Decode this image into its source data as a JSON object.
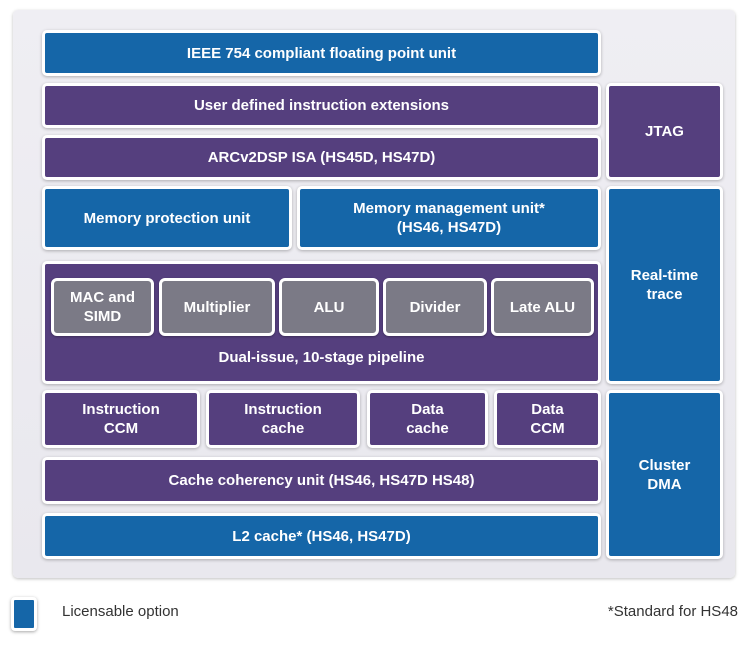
{
  "colors": {
    "licensable_blue": "#1566a8",
    "standard_purple": "#553f7e",
    "functional_unit_gray": "#7b7a86",
    "panel_background": "#ecebf1"
  },
  "blocks": {
    "fpu": "IEEE 754 compliant floating point unit",
    "user_defined": "User defined instruction extensions",
    "arcv2dsp": "ARCv2DSP ISA (HS45D, HS47D)",
    "jtag": "JTAG",
    "mpu": "Memory protection unit",
    "mmu_line1": "Memory management unit*",
    "mmu_line2": "(HS46, HS47D)",
    "realtime_trace_line1": "Real-time",
    "realtime_trace_line2": "trace",
    "pipeline": {
      "label": "Dual-issue, 10-stage pipeline",
      "units": [
        {
          "line1": "MAC and",
          "line2": "SIMD"
        },
        {
          "line1": "Multiplier",
          "line2": ""
        },
        {
          "line1": "ALU",
          "line2": ""
        },
        {
          "line1": "Divider",
          "line2": ""
        },
        {
          "line1": "Late ALU",
          "line2": ""
        }
      ]
    },
    "memories": [
      {
        "line1": "Instruction",
        "line2": "CCM"
      },
      {
        "line1": "Instruction",
        "line2": "cache"
      },
      {
        "line1": "Data",
        "line2": "cache"
      },
      {
        "line1": "Data",
        "line2": "CCM"
      }
    ],
    "cache_coherency": "Cache coherency unit (HS46, HS47D HS48)",
    "l2_cache": "L2 cache* (HS46, HS47D)",
    "cluster_dma_line1": "Cluster",
    "cluster_dma_line2": "DMA"
  },
  "legend": {
    "licensable_label": "Licensable option",
    "footnote": "*Standard for HS48"
  }
}
